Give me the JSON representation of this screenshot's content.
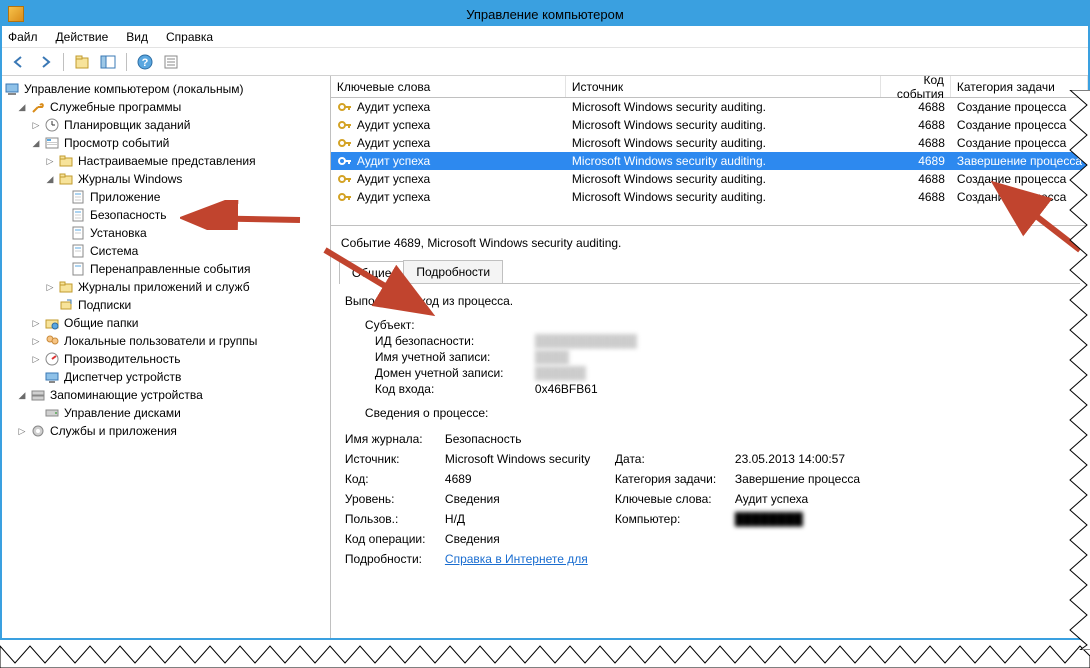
{
  "window": {
    "title": "Управление компьютером"
  },
  "menubar": {
    "file": "Файл",
    "action": "Действие",
    "view": "Вид",
    "help": "Справка"
  },
  "tree": {
    "root": "Управление компьютером (локальным)",
    "system_tools": "Служебные программы",
    "task_scheduler": "Планировщик заданий",
    "event_viewer": "Просмотр событий",
    "custom_views": "Настраиваемые представления",
    "windows_logs": "Журналы Windows",
    "application": "Приложение",
    "security": "Безопасность",
    "setup": "Установка",
    "system": "Система",
    "forwarded": "Перенаправленные события",
    "app_services_logs": "Журналы приложений и служб",
    "subscriptions": "Подписки",
    "shared_folders": "Общие папки",
    "local_users": "Локальные пользователи и группы",
    "performance": "Производительность",
    "device_manager": "Диспетчер устройств",
    "storage": "Запоминающие устройства",
    "disk_mgmt": "Управление дисками",
    "services_apps": "Службы и приложения"
  },
  "event_columns": {
    "keywords": "Ключевые слова",
    "source": "Источник",
    "event_id": "Код события",
    "task_category": "Категория задачи"
  },
  "events": [
    {
      "keywords": "Аудит успеха",
      "source": "Microsoft Windows security auditing.",
      "id": "4688",
      "category": "Создание процесса",
      "selected": false
    },
    {
      "keywords": "Аудит успеха",
      "source": "Microsoft Windows security auditing.",
      "id": "4688",
      "category": "Создание процесса",
      "selected": false
    },
    {
      "keywords": "Аудит успеха",
      "source": "Microsoft Windows security auditing.",
      "id": "4688",
      "category": "Создание процесса",
      "selected": false
    },
    {
      "keywords": "Аудит успеха",
      "source": "Microsoft Windows security auditing.",
      "id": "4689",
      "category": "Завершение процесса",
      "selected": true
    },
    {
      "keywords": "Аудит успеха",
      "source": "Microsoft Windows security auditing.",
      "id": "4688",
      "category": "Создание процесса",
      "selected": false
    },
    {
      "keywords": "Аудит успеха",
      "source": "Microsoft Windows security auditing.",
      "id": "4688",
      "category": "Создание процесса",
      "selected": false
    }
  ],
  "detail": {
    "header": "Событие 4689, Microsoft Windows security auditing.",
    "tab_general": "Общие",
    "tab_details": "Подробности",
    "msg_title": "Выполнен выход из процесса.",
    "subject": "Субъект:",
    "sid": "ИД безопасности:",
    "account_name": "Имя учетной записи:",
    "account_domain": "Домен учетной записи:",
    "logon_id": "Код входа:",
    "logon_id_val": "0x46BFB61",
    "process_info": "Сведения о процессе:",
    "log_name": "Имя журнала:",
    "log_name_val": "Безопасность",
    "source": "Источник:",
    "source_val": "Microsoft Windows security",
    "date": "Дата:",
    "date_val": "23.05.2013 14:00:57",
    "code": "Код:",
    "code_val": "4689",
    "task_cat": "Категория задачи:",
    "task_cat_val": "Завершение процесса",
    "level": "Уровень:",
    "level_val": "Сведения",
    "keywords": "Ключевые слова:",
    "keywords_val": "Аудит успеха",
    "user": "Пользов.:",
    "user_val": "Н/Д",
    "computer": "Компьютер:",
    "opcode": "Код операции:",
    "opcode_val": "Сведения",
    "more_info": "Подробности:",
    "help_link": "Справка в Интернете для"
  }
}
